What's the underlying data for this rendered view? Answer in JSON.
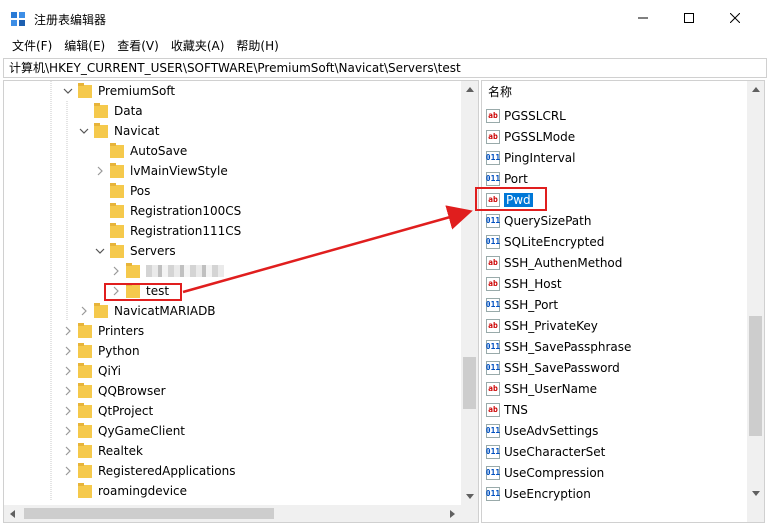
{
  "window": {
    "title": "注册表编辑器"
  },
  "menu": [
    "文件(F)",
    "编辑(E)",
    "查看(V)",
    "收藏夹(A)",
    "帮助(H)"
  ],
  "address": "计算机\\HKEY_CURRENT_USER\\SOFTWARE\\PremiumSoft\\Navicat\\Servers\\test",
  "tree": {
    "items": [
      {
        "label": "PremiumSoft"
      },
      {
        "label": "Data"
      },
      {
        "label": "Navicat"
      },
      {
        "label": "AutoSave"
      },
      {
        "label": "lvMainViewStyle"
      },
      {
        "label": "Pos"
      },
      {
        "label": "Registration100CS"
      },
      {
        "label": "Registration111CS"
      },
      {
        "label": "Servers"
      },
      {
        "label": ""
      },
      {
        "label": "test"
      },
      {
        "label": "NavicatMARIADB"
      },
      {
        "label": "Printers"
      },
      {
        "label": "Python"
      },
      {
        "label": "QiYi"
      },
      {
        "label": "QQBrowser"
      },
      {
        "label": "QtProject"
      },
      {
        "label": "QyGameClient"
      },
      {
        "label": "Realtek"
      },
      {
        "label": "RegisteredApplications"
      },
      {
        "label": "roamingdevice"
      }
    ]
  },
  "list": {
    "header": "名称",
    "items": [
      {
        "label": "PGSSLCRL",
        "type": "ab"
      },
      {
        "label": "PGSSLMode",
        "type": "ab"
      },
      {
        "label": "PingInterval",
        "type": "bin"
      },
      {
        "label": "Port",
        "type": "bin"
      },
      {
        "label": "Pwd",
        "type": "ab"
      },
      {
        "label": "QuerySizePath",
        "type": "bin"
      },
      {
        "label": "SQLiteEncrypted",
        "type": "bin"
      },
      {
        "label": "SSH_AuthenMethod",
        "type": "ab"
      },
      {
        "label": "SSH_Host",
        "type": "ab"
      },
      {
        "label": "SSH_Port",
        "type": "bin"
      },
      {
        "label": "SSH_PrivateKey",
        "type": "ab"
      },
      {
        "label": "SSH_SavePassphrase",
        "type": "bin"
      },
      {
        "label": "SSH_SavePassword",
        "type": "bin"
      },
      {
        "label": "SSH_UserName",
        "type": "ab"
      },
      {
        "label": "TNS",
        "type": "ab"
      },
      {
        "label": "UseAdvSettings",
        "type": "bin"
      },
      {
        "label": "UseCharacterSet",
        "type": "bin"
      },
      {
        "label": "UseCompression",
        "type": "bin"
      },
      {
        "label": "UseEncryption",
        "type": "bin"
      }
    ]
  },
  "colors": {
    "accent": "#0078d7",
    "annotation": "#e01e1e",
    "folder": "#f5c94c"
  }
}
